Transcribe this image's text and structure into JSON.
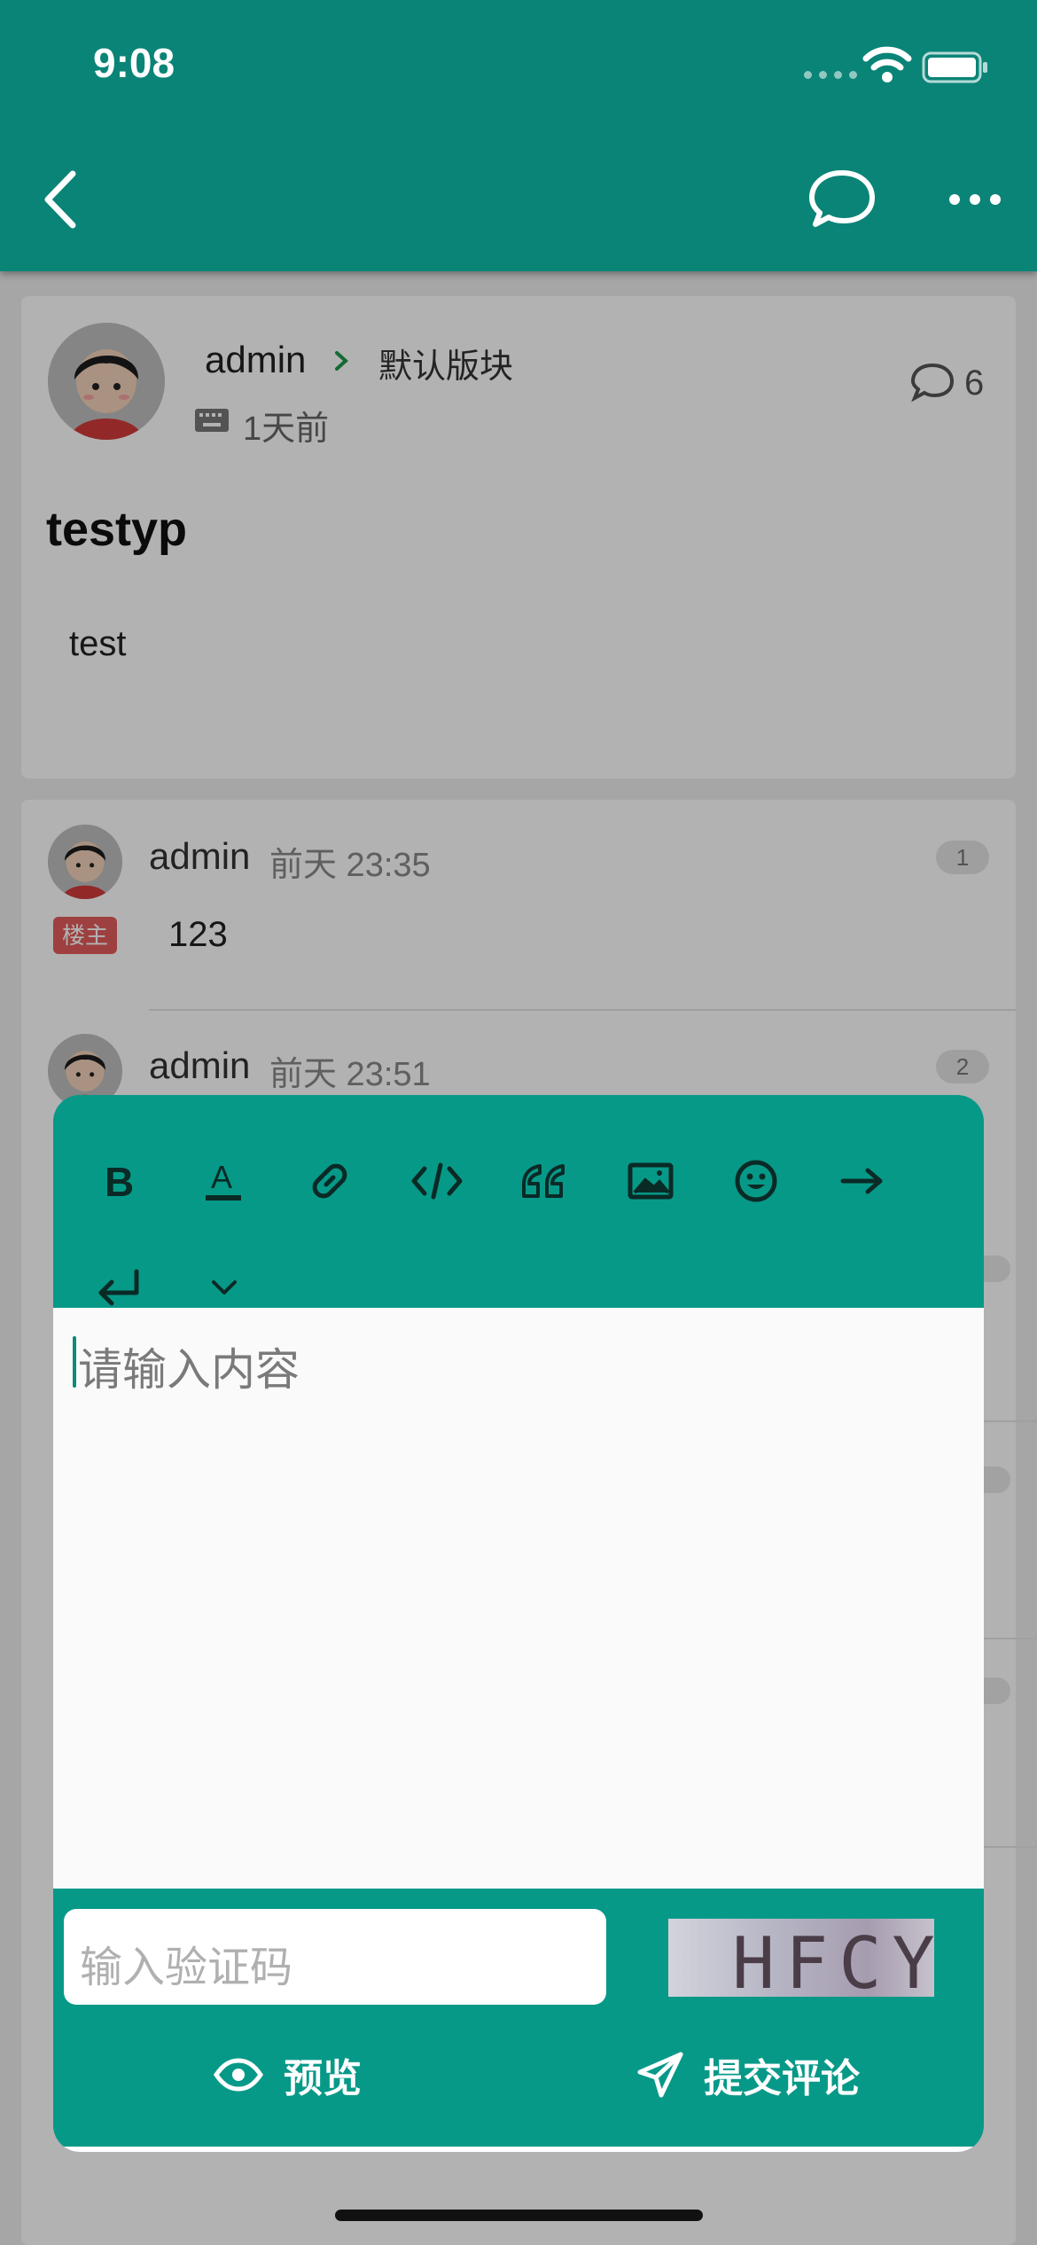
{
  "status_bar": {
    "time": "9:08"
  },
  "post": {
    "author": "admin",
    "board": "默认版块",
    "time": "1天前",
    "comment_count": "6",
    "title": "testyp",
    "body": "test"
  },
  "comments": [
    {
      "author": "admin",
      "time": "前天 23:35",
      "floor": "1",
      "badge": "楼主",
      "body": "123"
    },
    {
      "author": "admin",
      "time": "前天 23:51",
      "floor": "2"
    }
  ],
  "editor": {
    "toolbar": [
      "bold-icon",
      "text-color-icon",
      "link-icon",
      "code-icon",
      "quote-icon",
      "image-icon",
      "emoji-icon",
      "indent-icon",
      "newline-icon",
      "collapse-icon"
    ],
    "placeholder": "请输入内容",
    "captcha_placeholder": "输入验证码",
    "captcha_image_text": "HFCY",
    "preview_label": "预览",
    "submit_label": "提交评论"
  },
  "colors": {
    "header": "#0a8477",
    "editor": "#079988",
    "badge": "#e25c5c"
  }
}
